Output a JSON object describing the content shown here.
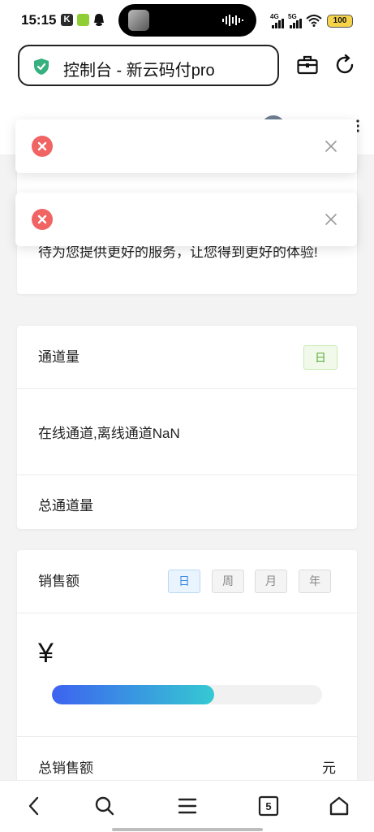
{
  "status_bar": {
    "time": "15:15",
    "app_badge": "K",
    "net_1": "4G",
    "net_2": "5G",
    "battery": "100"
  },
  "browser": {
    "url_title": "控制台 - 新云码付pro"
  },
  "welcome": {
    "text": "待为您提供更好的服务，让您得到更好的体验!"
  },
  "channel": {
    "title": "通道量",
    "day_tag": "日",
    "status": "在线通道,离线通道NaN",
    "total_label": "总通道量"
  },
  "sales": {
    "title": "销售额",
    "periods": [
      "日",
      "周",
      "月",
      "年"
    ],
    "active_period": "日",
    "currency": "¥",
    "progress": 0.6,
    "total_label": "总销售额",
    "unit": "元"
  },
  "bottom_nav": {
    "tab_count": "5"
  },
  "colors": {
    "error": "#f06464",
    "accent_blue": "#3c8ae0",
    "accent_green": "#5aa83a",
    "progress_start": "#3d63f0",
    "progress_end": "#35c9d2"
  }
}
